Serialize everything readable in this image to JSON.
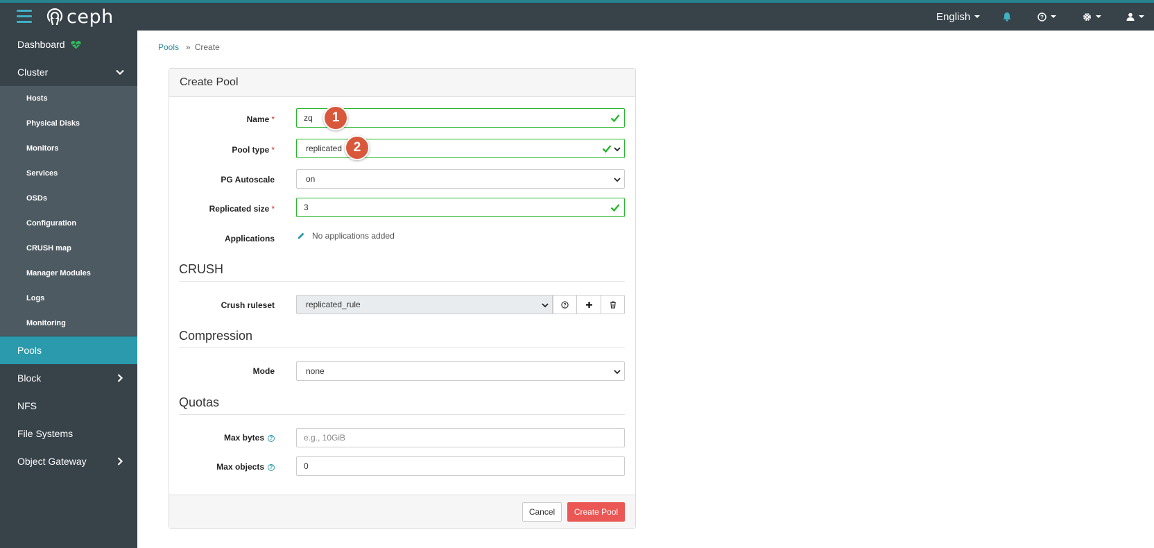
{
  "brand": {
    "name": "ceph"
  },
  "navbar": {
    "language": "English",
    "icons": [
      "bell-icon",
      "help-icon",
      "gear-icon",
      "user-icon"
    ]
  },
  "sidebar": {
    "dashboard": "Dashboard",
    "cluster": "Cluster",
    "cluster_items": [
      "Hosts",
      "Physical Disks",
      "Monitors",
      "Services",
      "OSDs",
      "Configuration",
      "CRUSH map",
      "Manager Modules",
      "Logs",
      "Monitoring"
    ],
    "pools": "Pools",
    "block": "Block",
    "nfs": "NFS",
    "file_systems": "File Systems",
    "object_gateway": "Object Gateway"
  },
  "breadcrumb": {
    "parent": "Pools",
    "separator": "»",
    "current": "Create"
  },
  "form": {
    "title": "Create Pool",
    "name": {
      "label": "Name",
      "value": "zq"
    },
    "pool_type": {
      "label": "Pool type",
      "value": "replicated"
    },
    "pg_autoscale": {
      "label": "PG Autoscale",
      "value": "on"
    },
    "replicated_size": {
      "label": "Replicated size",
      "value": "3"
    },
    "applications": {
      "label": "Applications",
      "value": "No applications added"
    },
    "required_mark": "*",
    "crush": {
      "section": "CRUSH",
      "ruleset_label": "Crush ruleset",
      "ruleset_value": "replicated_rule"
    },
    "compression": {
      "section": "Compression",
      "mode_label": "Mode",
      "mode_value": "none"
    },
    "quotas": {
      "section": "Quotas",
      "max_bytes_label": "Max bytes",
      "max_bytes_placeholder": "e.g., 10GiB",
      "max_objects_label": "Max objects",
      "max_objects_value": "0"
    },
    "cancel": "Cancel",
    "submit": "Create Pool"
  },
  "annotations": {
    "badge1": "1",
    "badge2": "2"
  },
  "colors": {
    "accent": "#2a9aac",
    "navbar": "#374249",
    "valid": "#28b62c",
    "danger": "#ea5754",
    "badge": "#d9583b"
  }
}
